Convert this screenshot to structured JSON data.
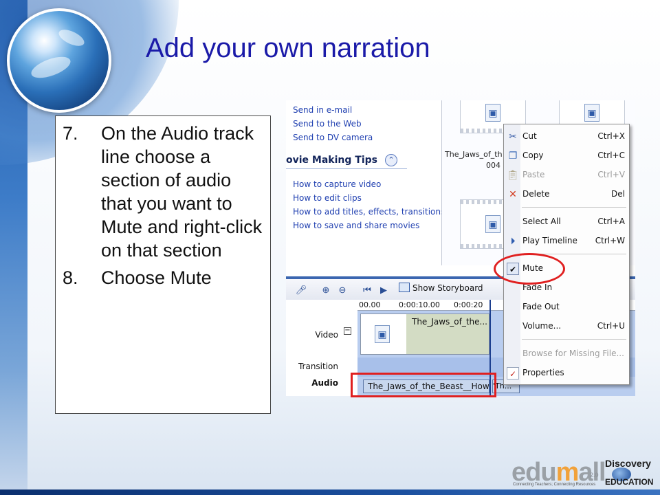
{
  "slide": {
    "title": "Add your own narration",
    "steps": [
      {
        "num": "7.",
        "text": "On the Audio track line choose a section of audio that you want to Mute and right-click on that section"
      },
      {
        "num": "8.",
        "text": "Choose Mute"
      }
    ],
    "colors": {
      "title": "#1a1aa8",
      "highlight": "#e02020",
      "accent": "#3b66b0"
    }
  },
  "task_pane": {
    "links_top": [
      "Send in e-mail",
      "Send to the Web",
      "Send to DV camera"
    ],
    "tips_header": "ovie Making Tips",
    "tips_links": [
      "How to capture video",
      "How to edit clips",
      "How to add titles, effects, transitions",
      "How to save and share movies"
    ]
  },
  "collection": {
    "clip_label": "The_Jaws_of_th",
    "clip_label_line2": "004",
    "clip_label_cut": "t."
  },
  "timeline": {
    "show_storyboard": "Show Storyboard",
    "ruler_ticks": [
      "00.00",
      "0:00:10.00",
      "0:00:20"
    ],
    "track_labels": {
      "video": "Video",
      "transition": "Transition",
      "audio": "Audio"
    },
    "video_clip_title": "The_Jaws_of_the...",
    "audio_clip_title": "The_Jaws_of_the_Beast__How...",
    "audio_next": "'Th..."
  },
  "context_menu": {
    "items": [
      {
        "label": "Cut",
        "shortcut": "Ctrl+X",
        "icon": "scissors-icon",
        "disabled": false
      },
      {
        "label": "Copy",
        "shortcut": "Ctrl+C",
        "icon": "copy-icon",
        "disabled": false
      },
      {
        "label": "Paste",
        "shortcut": "Ctrl+V",
        "icon": "paste-icon",
        "disabled": true
      },
      {
        "label": "Delete",
        "shortcut": "Del",
        "icon": "delete-x-icon",
        "disabled": false
      },
      {
        "label": "Select All",
        "shortcut": "Ctrl+A",
        "icon": "",
        "disabled": false
      },
      {
        "label": "Play Timeline",
        "shortcut": "Ctrl+W",
        "icon": "play-icon",
        "disabled": false
      },
      {
        "label": "Mute",
        "shortcut": "",
        "icon": "checkmark-icon",
        "disabled": false,
        "checked": true
      },
      {
        "label": "Fade In",
        "shortcut": "",
        "icon": "",
        "disabled": false
      },
      {
        "label": "Fade Out",
        "shortcut": "",
        "icon": "",
        "disabled": false
      },
      {
        "label": "Volume...",
        "shortcut": "Ctrl+U",
        "icon": "",
        "disabled": false
      },
      {
        "label": "Browse for Missing File...",
        "shortcut": "",
        "icon": "",
        "disabled": true
      },
      {
        "label": "Properties",
        "shortcut": "",
        "icon": "properties-icon",
        "disabled": false
      }
    ]
  },
  "logos": {
    "edumall_pre": "edu",
    "edumall_m": "m",
    "edumall_post": "all",
    "edumall_version": "2.0",
    "edumall_tagline": "Connecting Teachers; Connecting Resources",
    "discovery_line1": "Discovery",
    "discovery_line2": "EDUCATION"
  }
}
